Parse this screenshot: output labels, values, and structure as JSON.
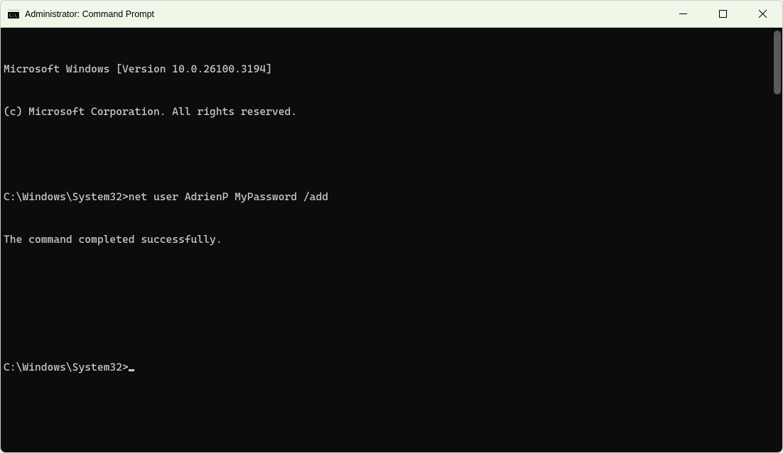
{
  "window": {
    "title": "Administrator: Command Prompt"
  },
  "terminal": {
    "line1": "Microsoft Windows [Version 10.0.26100.3194]",
    "line2": "(c) Microsoft Corporation. All rights reserved.",
    "blank": "",
    "prompt1_path": "C:\\Windows\\System32>",
    "command1": "net user AdrienP MyPassword /add",
    "response1": "The command completed successfully.",
    "prompt2_path": "C:\\Windows\\System32>"
  }
}
